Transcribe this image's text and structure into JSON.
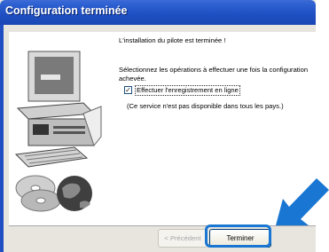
{
  "window": {
    "title": "Configuration terminée"
  },
  "message": {
    "line1": "L'installation du pilote est terminée !",
    "line2a": "Sélectionnez les opérations à effectuer une fois la configuration",
    "line2b": "achevée.",
    "note": "(Ce service n'est pas disponible dans tous les pays.)"
  },
  "option": {
    "label": "Effectuer l'enregistrement en ligne",
    "checked": true,
    "check_glyph": "✓"
  },
  "buttons": {
    "previous": "< Précédent",
    "finish": "Terminer"
  },
  "colors": {
    "title_bar": "#1f4fc2",
    "highlight": "#1976d2",
    "arrow": "#1976d2"
  }
}
